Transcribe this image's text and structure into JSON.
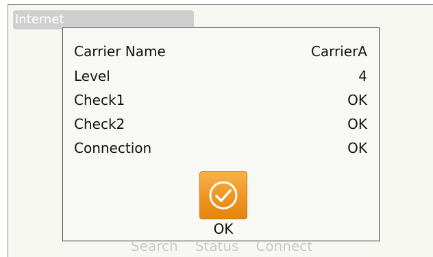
{
  "screen": {
    "tab_title": "Internet",
    "bottom_buttons": [
      "Search",
      "Status",
      "Connect"
    ]
  },
  "dialog": {
    "rows": [
      {
        "label": "Carrier Name",
        "value": "CarrierA"
      },
      {
        "label": "Level",
        "value": "4"
      },
      {
        "label": "Check1",
        "value": "OK"
      },
      {
        "label": "Check2",
        "value": "OK"
      },
      {
        "label": "Connection",
        "value": "OK"
      }
    ],
    "ok_label": "OK",
    "ok_icon": "checkmark-circle-icon",
    "ok_color": "#ee9421"
  }
}
